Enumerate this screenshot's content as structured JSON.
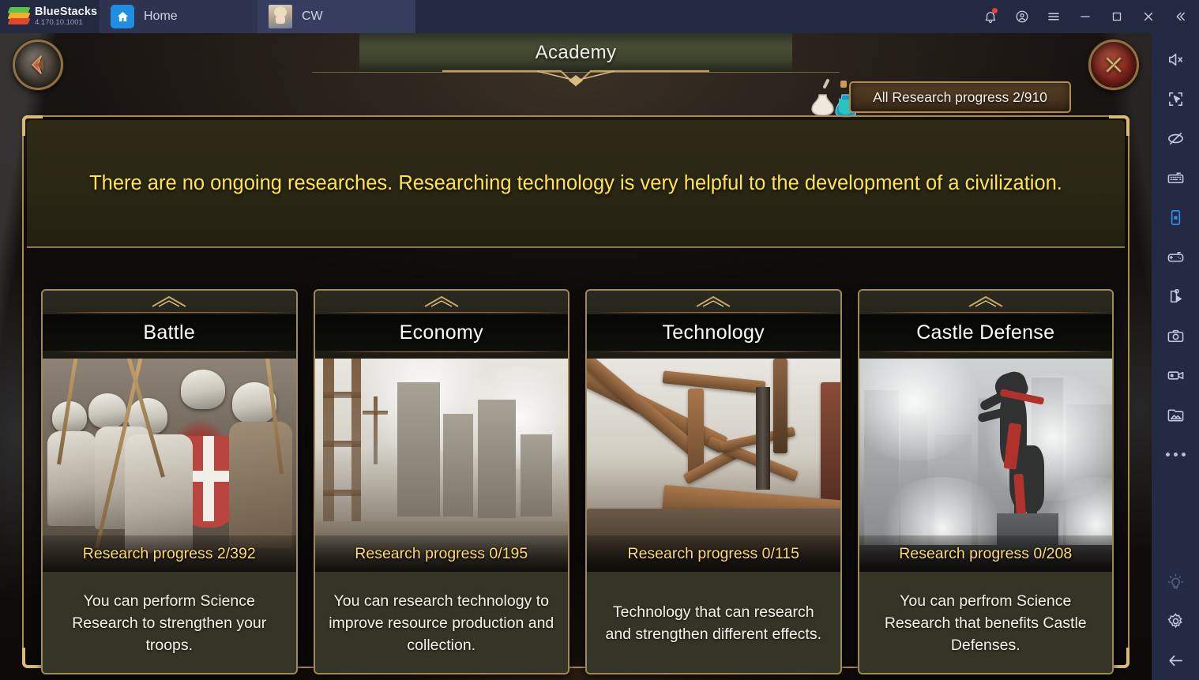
{
  "titlebar": {
    "brand_name": "BlueStacks",
    "version": "4.170.10.1001",
    "tabs": [
      {
        "label": "Home",
        "icon": "home-icon"
      },
      {
        "label": "CW",
        "icon": "app-avatar"
      }
    ],
    "buttons": [
      {
        "name": "notifications-button",
        "icon": "bell-icon",
        "badge": true
      },
      {
        "name": "account-button",
        "icon": "account-icon"
      },
      {
        "name": "menu-button",
        "icon": "hamburger-icon"
      },
      {
        "name": "minimize-button",
        "icon": "minimize-icon"
      },
      {
        "name": "maximize-button",
        "icon": "maximize-icon"
      },
      {
        "name": "close-button",
        "icon": "close-icon"
      },
      {
        "name": "collapse-toolbar-button",
        "icon": "chevron-double-left-icon"
      }
    ]
  },
  "game": {
    "header": {
      "title": "Academy",
      "back_button_icon": "back-arrow-gem-icon",
      "close_button_icon": "close-x-icon",
      "research_chip": "All Research progress 2/910",
      "research_chip_icon": "flask-icon"
    },
    "notice": "There are no ongoing researches. Researching technology is very helpful to the development of a civilization.",
    "cards": [
      {
        "title": "Battle",
        "progress": "Research progress 2/392",
        "description": "You can perform Science Research to strengthen your troops.",
        "art": "knights-battle-art"
      },
      {
        "title": "Economy",
        "progress": "Research progress 0/195",
        "description": "You can research technology to improve resource production and collection.",
        "art": "ruined-city-art"
      },
      {
        "title": "Technology",
        "progress": "Research progress 0/115",
        "description": "Technology that can research and strengthen different effects.",
        "art": "siege-engine-art"
      },
      {
        "title": "Castle Defense",
        "progress": "Research progress 0/208",
        "description": "You can perfrom Science Research that benefits Castle Defenses.",
        "art": "rearing-horse-castle-art"
      }
    ]
  },
  "sidebar": {
    "items": [
      {
        "name": "fullscreen-icon"
      },
      {
        "name": "mute-icon"
      },
      {
        "name": "multi-instance-icon"
      },
      {
        "name": "eye-off-icon"
      },
      {
        "name": "keyboard-controls-icon"
      },
      {
        "name": "rotate-phone-icon"
      },
      {
        "name": "gamepad-icon"
      },
      {
        "name": "macro-script-icon"
      },
      {
        "name": "screenshot-icon"
      },
      {
        "name": "screen-record-icon"
      },
      {
        "name": "media-manager-icon"
      },
      {
        "name": "more-options-icon"
      }
    ],
    "bottom_items": [
      {
        "name": "brightness-icon"
      },
      {
        "name": "settings-gear-icon"
      },
      {
        "name": "back-arrow-icon"
      }
    ]
  },
  "colors": {
    "titlebar_bg": "#242942",
    "sidebar_bg": "#252a44",
    "accent_blue": "#2e8fe6",
    "gold_frame": "#a98b52",
    "notice_text": "#ffe44f",
    "progress_text": "#ffdc6b",
    "card_desc_bg": "#343526"
  }
}
